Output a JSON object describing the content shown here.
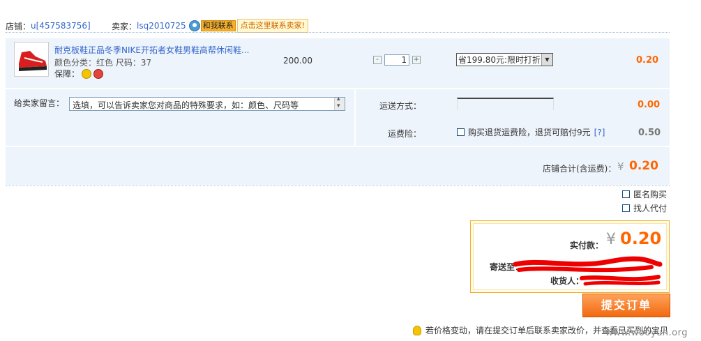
{
  "shop": {
    "label": "店铺：",
    "name": "u[457583756]",
    "seller_label": "卖家：",
    "seller_name": "lsq2010725",
    "talk_label": "和我联系",
    "contact_tip": "点击这里联系卖家!"
  },
  "item": {
    "title": "耐克板鞋正品冬季NIKE开拓者女鞋男鞋高帮休闲鞋...",
    "sku": "颜色分类：红色   尺码：37",
    "guarantee_label": "保障：",
    "price": "200.00",
    "quantity": "1",
    "qty_minus": "-",
    "qty_plus": "+",
    "promotion": "省199.80元:限时打折",
    "subtotal": "0.20"
  },
  "message": {
    "label": "给卖家留言：",
    "placeholder": "选填，可以告诉卖家您对商品的特殊要求，如：颜色、尺码等"
  },
  "shipping": {
    "method_label": "运送方式：",
    "method_fee": "0.00",
    "insurance_label": "运费险：",
    "insurance_option": "购买退货运费险，退货可赔付9元",
    "insurance_help": "[?]",
    "insurance_fee": "0.50"
  },
  "shop_total": {
    "label": "店铺合计(含运费)：",
    "currency": "¥",
    "value": "0.20"
  },
  "options": {
    "anonymous": "匿名购买",
    "proxy_pay": "找人代付"
  },
  "payment": {
    "label": "实付款：",
    "currency": "¥",
    "value": "0.20",
    "ship_to_label": "寄送至：",
    "receiver_label": "收货人："
  },
  "submit_label": "提交订单",
  "bottom_tip": "若价格变动，请在提交订单后联系卖家改价，并查看已买到的宝贝",
  "watermark": "www.wooyun.org",
  "colors": {
    "accent_orange": "#ff6600",
    "link_blue": "#3366cc",
    "row_bg": "#eef4fb"
  }
}
